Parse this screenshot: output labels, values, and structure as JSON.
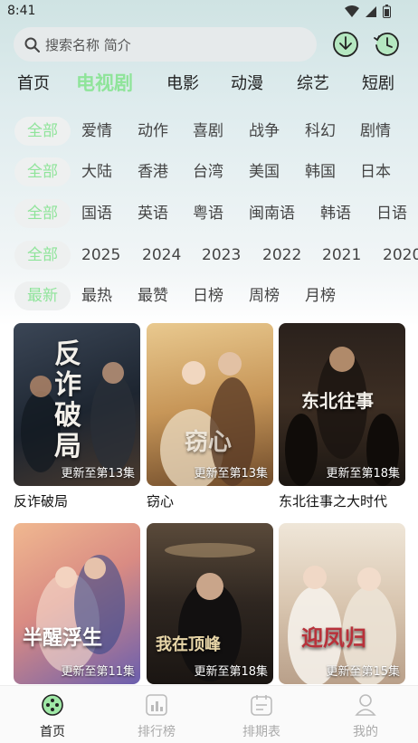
{
  "status_bar": {
    "time": "8:41"
  },
  "search": {
    "placeholder": "搜索名称 简介"
  },
  "header_icons": [
    "download-icon",
    "history-icon"
  ],
  "category_tabs": [
    {
      "label": "首页",
      "active": false
    },
    {
      "label": "电视剧",
      "active": true
    },
    {
      "label": "电影",
      "active": false
    },
    {
      "label": "动漫",
      "active": false
    },
    {
      "label": "综艺",
      "active": false
    },
    {
      "label": "短剧",
      "active": false
    }
  ],
  "filters": {
    "genre": [
      "全部",
      "爱情",
      "动作",
      "喜剧",
      "战争",
      "科幻",
      "剧情"
    ],
    "region": [
      "全部",
      "大陆",
      "香港",
      "台湾",
      "美国",
      "韩国",
      "日本"
    ],
    "language": [
      "全部",
      "国语",
      "英语",
      "粤语",
      "闽南语",
      "韩语",
      "日语"
    ],
    "year": [
      "全部",
      "2025",
      "2024",
      "2023",
      "2022",
      "2021",
      "2020"
    ],
    "sort": [
      "最新",
      "最热",
      "最赞",
      "日榜",
      "周榜",
      "月榜"
    ]
  },
  "shows": [
    {
      "title": "反诈破局",
      "poster_text": "反诈破局",
      "episode": "更新至第13集"
    },
    {
      "title": "窃心",
      "poster_text": "窃心",
      "episode": "更新至第13集"
    },
    {
      "title": "东北往事之大时代",
      "poster_text": "东北往事",
      "episode": "更新至第18集"
    },
    {
      "title": "",
      "poster_text": "半醒浮生",
      "episode": "更新至第11集"
    },
    {
      "title": "",
      "poster_text": "我在顶峰",
      "episode": "更新至第18集"
    },
    {
      "title": "",
      "poster_text": "迎凤归",
      "episode": "更新至第15集"
    }
  ],
  "bottom_nav": [
    {
      "label": "首页",
      "icon": "home-icon",
      "active": true
    },
    {
      "label": "排行榜",
      "icon": "ranking-icon",
      "active": false
    },
    {
      "label": "排期表",
      "icon": "calendar-icon",
      "active": false
    },
    {
      "label": "我的",
      "icon": "profile-icon",
      "active": false
    }
  ],
  "colors": {
    "accent": "#8fe49a",
    "chip_bg": "#eef0f0",
    "search_bg": "#e6eaeb"
  }
}
